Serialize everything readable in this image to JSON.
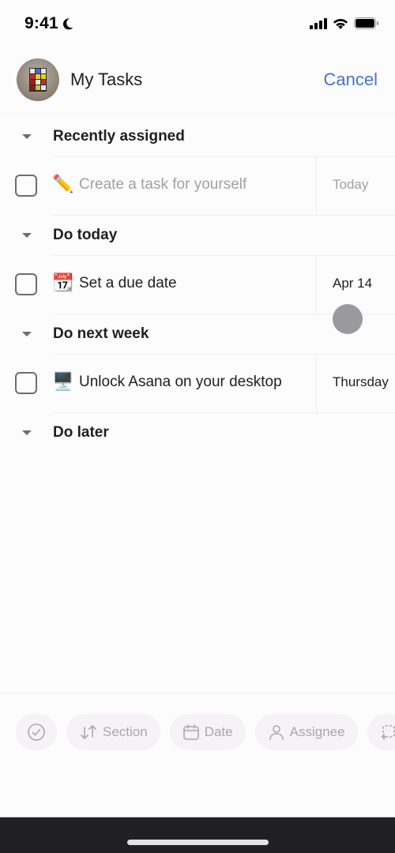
{
  "status_bar": {
    "time": "9:41",
    "focus_icon": "moon-icon",
    "icons": [
      "signal-icon",
      "wifi-icon",
      "battery-icon"
    ]
  },
  "header": {
    "title": "My Tasks",
    "cancel_label": "Cancel",
    "avatar": "rubiks-cube-avatar",
    "accent_color": "#4573d2"
  },
  "sections": [
    {
      "label": "Recently assigned",
      "tasks": [
        {
          "emoji": "✏️",
          "name": "Create a task for yourself",
          "placeholder": true,
          "due": "Today"
        }
      ]
    },
    {
      "label": "Do today",
      "tasks": [
        {
          "emoji": "📆",
          "name": "Set a due date",
          "placeholder": false,
          "due": "Apr 14"
        }
      ]
    },
    {
      "label": "Do next week",
      "tasks": [
        {
          "emoji": "🖥️",
          "name": "Unlock Asana on your desktop",
          "placeholder": false,
          "due": "Thursday"
        }
      ]
    },
    {
      "label": "Do later",
      "tasks": []
    }
  ],
  "toolbar": {
    "complete_icon": "check-circle-icon",
    "section_label": "Section",
    "date_label": "Date",
    "assignee_label": "Assignee",
    "more_icon": "project-add-icon"
  }
}
